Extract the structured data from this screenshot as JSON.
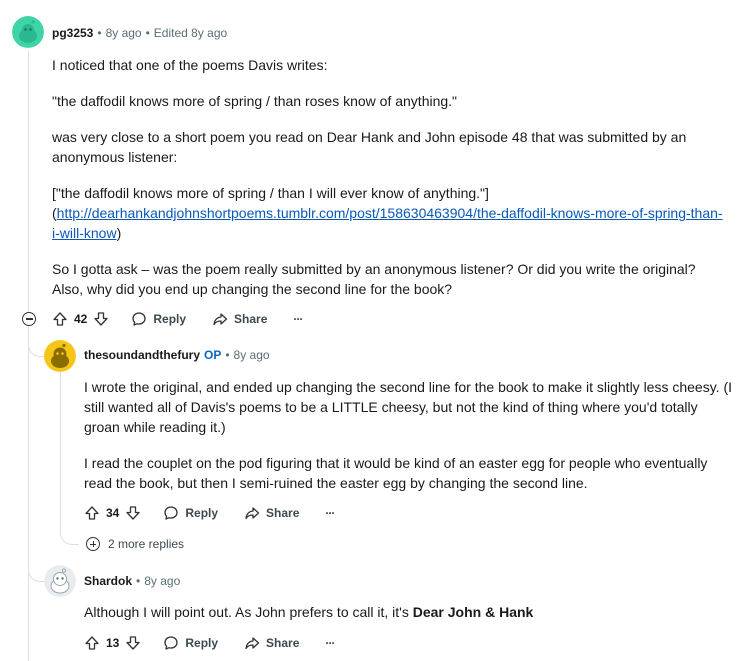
{
  "comment1": {
    "username": "pg3253",
    "age": "8y ago",
    "edited": "Edited 8y ago",
    "p1": "I noticed that one of the poems Davis writes:",
    "p2": "\"the daffodil knows more of spring / than roses know of anything.\"",
    "p3": "was very close to a short poem you read on Dear Hank and John episode 48 that was submitted by an anonymous listener:",
    "p4_quote": "[\"the daffodil knows more of spring / than I will ever know of anything.\"]",
    "p4_open": "(",
    "p4_link": "http://dearhankandjohnshortpoems.tumblr.com/post/158630463904/the-daffodil-knows-more-of-spring-than-i-will-know",
    "p4_close": ")",
    "p5": "So I gotta ask – was the poem really submitted by an anonymous listener? Or did you write the original? Also, why did you end up changing the second line for the book?",
    "votes": "42",
    "reply_label": "Reply",
    "share_label": "Share",
    "more_label": "···"
  },
  "comment2": {
    "username": "thesoundandthefury",
    "op_label": "OP",
    "age": "8y ago",
    "p1": "I wrote the original, and ended up changing the second line for the book to make it slightly less cheesy. (I still wanted all of Davis's poems to be a LITTLE cheesy, but not the kind of thing where you'd totally groan while reading it.)",
    "p2": "I read the couplet on the pod figuring that it would be kind of an easter egg for people who eventually read the book, but then I semi-ruined the easter egg by changing the second line.",
    "votes": "34",
    "reply_label": "Reply",
    "share_label": "Share",
    "more_label": "···",
    "more_replies": "2 more replies"
  },
  "comment3": {
    "username": "Shardok",
    "age": "8y ago",
    "text_prefix": "Although I will point out. As John prefers to call it, it's ",
    "text_bold": "Dear John & Hank",
    "votes": "13",
    "reply_label": "Reply",
    "share_label": "Share",
    "more_label": "···"
  },
  "colors": {
    "avatar1": "#3fd4a8",
    "avatar2": "#f5c518",
    "link": "#0a58b8",
    "op": "#0a66c2"
  }
}
